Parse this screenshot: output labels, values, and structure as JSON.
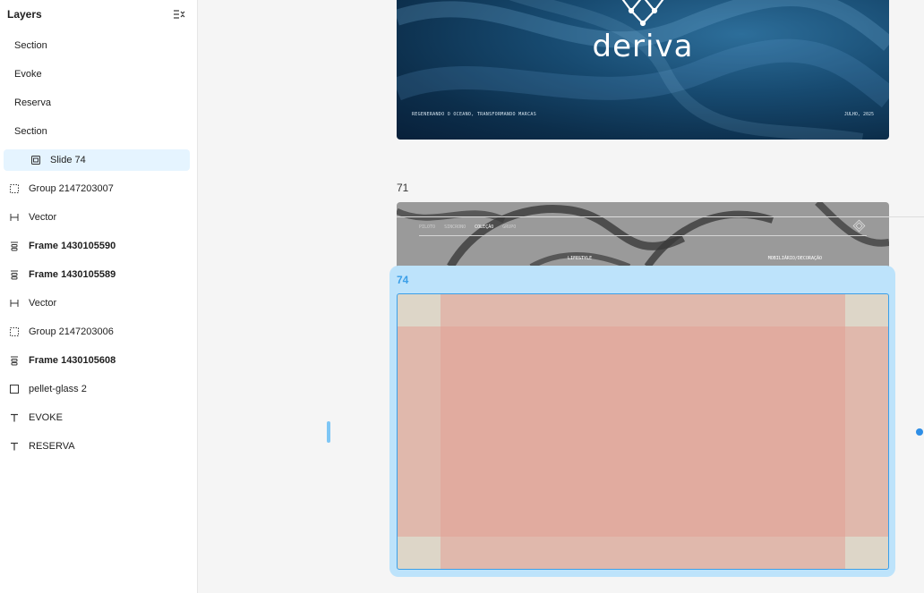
{
  "sidebar": {
    "title": "Layers",
    "collapse_icon": "list-collapse-icon",
    "items": [
      {
        "label": "Section",
        "icon": "none"
      },
      {
        "label": "Evoke",
        "icon": "none"
      },
      {
        "label": "Reserva",
        "icon": "none"
      },
      {
        "label": "Section",
        "icon": "none"
      },
      {
        "label": "Slide 74",
        "icon": "slide-icon",
        "selected": true
      },
      {
        "label": "Group 2147203007",
        "icon": "group-icon"
      },
      {
        "label": "Vector",
        "icon": "vector-icon"
      },
      {
        "label": "Frame 1430105590",
        "icon": "auto-layout-icon"
      },
      {
        "label": "Frame 1430105589",
        "icon": "auto-layout-icon"
      },
      {
        "label": "Vector",
        "icon": "vector-icon"
      },
      {
        "label": "Group 2147203006",
        "icon": "group-icon"
      },
      {
        "label": "Frame 1430105608",
        "icon": "auto-layout-icon"
      },
      {
        "label": "pellet-glass 2",
        "icon": "rectangle-icon"
      },
      {
        "label": "EVOKE",
        "icon": "text-icon"
      },
      {
        "label": "RESERVA",
        "icon": "text-icon"
      }
    ]
  },
  "canvas": {
    "slide_top": {
      "brand": "deriva",
      "tagline": "REGENERANDO O OCEANO, TRANSFORMANDO MARCAS",
      "date": "JULHO, 2025"
    },
    "slide_71": {
      "label": "71",
      "nav": [
        "PILOTO",
        "SINCRONO",
        "COLEÇÃO",
        "GRUPO"
      ],
      "tag_left": "LIFESTYLE",
      "tag_right": "MOBILIÁRIO/DECORAÇÃO"
    },
    "slide_74": {
      "label": "74"
    }
  },
  "colors": {
    "selection_accent": "#3b9fe8",
    "selection_panel": "#bde3fb",
    "grid_overlay": "#e2a096",
    "slide_top_bg": "#0c2e4b"
  }
}
